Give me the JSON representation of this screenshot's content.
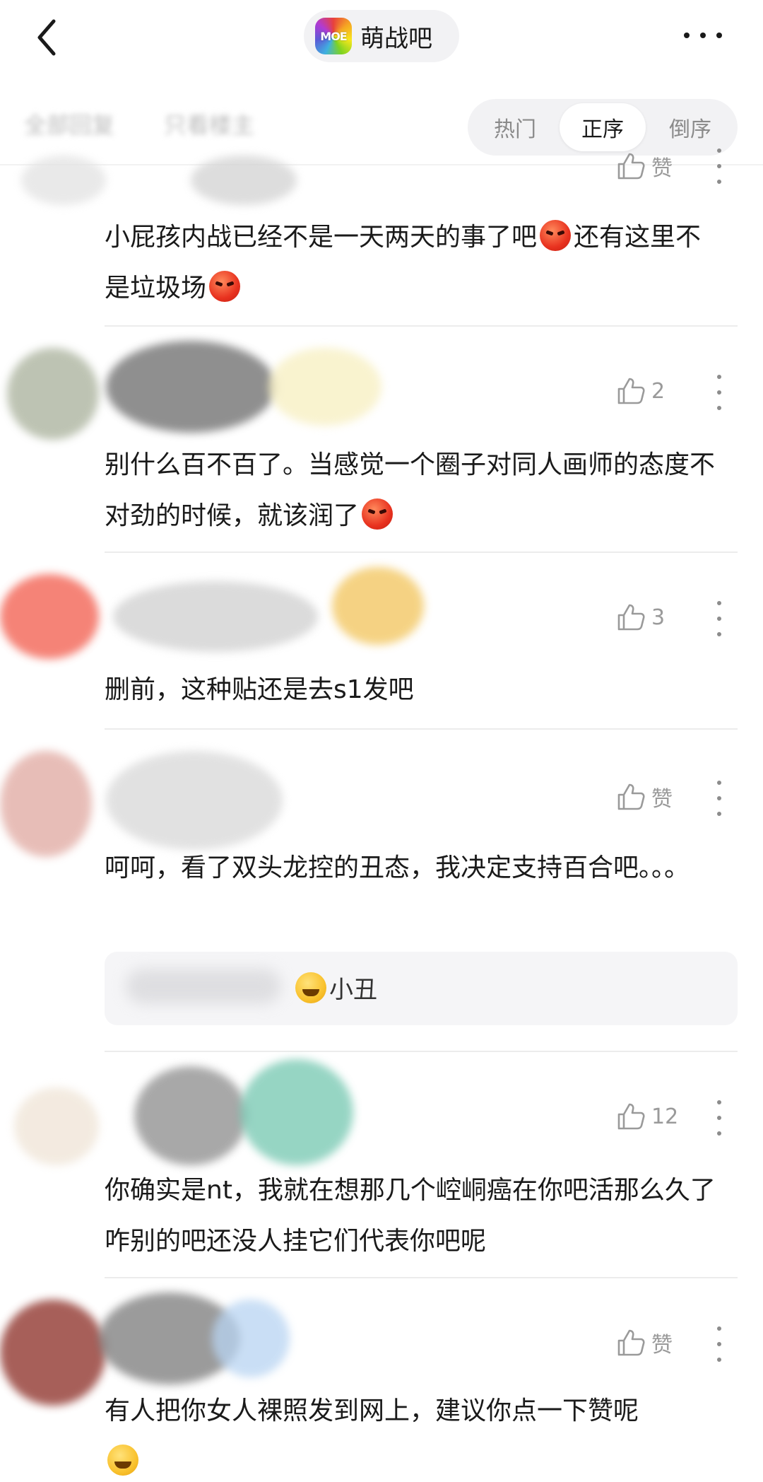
{
  "nav": {
    "forum_logo_text": "MOE",
    "forum_name": "萌战吧"
  },
  "filters": {
    "tabs": [
      "全部回复",
      "只看楼主"
    ],
    "sort_options": [
      "热门",
      "正序",
      "倒序"
    ],
    "active_sort": "正序"
  },
  "comments": [
    {
      "like_label": "赞",
      "text_parts": [
        "小屁孩内战已经不是一天两天的事了吧",
        "还有这里不是垃圾场"
      ],
      "emoji": "angry"
    },
    {
      "like_label": "2",
      "text_parts": [
        "别什么百不百了。当感觉一个圈子对同人画师的态度不对劲的时候，就该润了"
      ],
      "emoji": "angry"
    },
    {
      "like_label": "3",
      "text_parts": [
        "删前，这种贴还是去s1发吧"
      ]
    },
    {
      "like_label": "赞",
      "text_parts": [
        "呵呵，看了双头龙控的丑态，我决定支持百合吧。。。"
      ],
      "reply": "小丑",
      "reply_emoji": "grin-sweat"
    },
    {
      "like_label": "12",
      "text_parts": [
        "你确实是nt，我就在想那几个崆峒癌在你吧活那么久了咋别的吧还没人挂它们代表你吧呢"
      ]
    },
    {
      "like_label": "赞",
      "text_parts": [
        "有人把你女人裸照发到网上，建议你点一下赞呢"
      ],
      "emoji": "grin"
    }
  ]
}
